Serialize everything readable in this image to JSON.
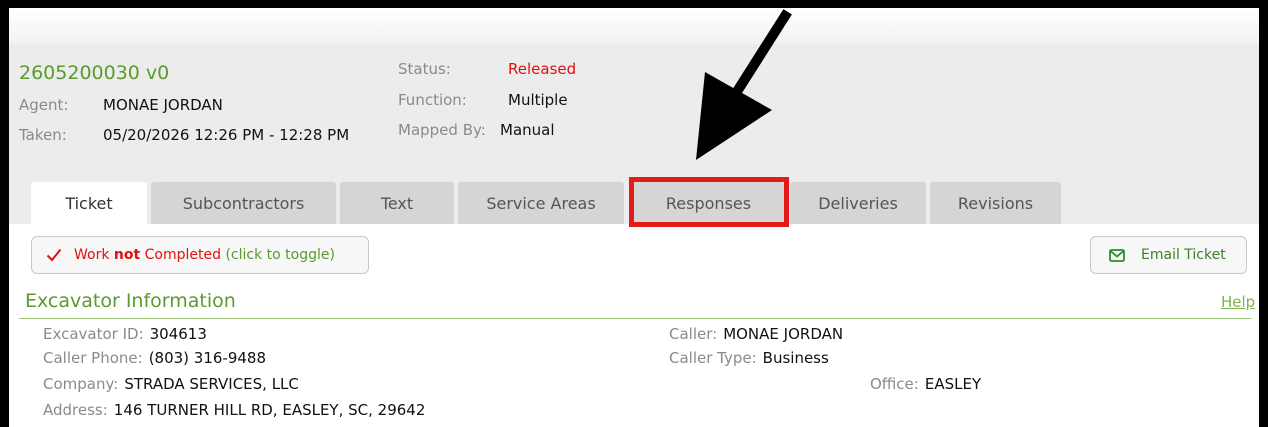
{
  "ticket": {
    "number": "2605200030 v0",
    "agent_label": "Agent:",
    "agent": "MONAE JORDAN",
    "taken_label": "Taken:",
    "taken": "05/20/2026 12:26 PM - 12:28 PM",
    "status_label": "Status:",
    "status": "Released",
    "function_label": "Function:",
    "function": "Multiple",
    "mapped_label": "Mapped By:",
    "mapped": "Manual"
  },
  "tabs": [
    {
      "label": "Ticket"
    },
    {
      "label": "Subcontractors"
    },
    {
      "label": "Text"
    },
    {
      "label": "Service Areas"
    },
    {
      "label": "Responses"
    },
    {
      "label": "Deliveries"
    },
    {
      "label": "Revisions"
    }
  ],
  "toggle": {
    "part1": "Work ",
    "part2": "not",
    "part3": " Completed",
    "hint": " (click to toggle)"
  },
  "email_button": "Email Ticket",
  "section": {
    "title": "Excavator Information",
    "help": "Help"
  },
  "excavator": {
    "excavator_id_label": "Excavator ID:",
    "excavator_id": "304613",
    "caller_phone_label": "Caller Phone:",
    "caller_phone": "(803) 316-9488",
    "company_label": "Company:",
    "company": "STRADA SERVICES, LLC",
    "address_label": "Address:",
    "address": "146 TURNER HILL RD, EASLEY, SC, 29642",
    "caller_label": "Caller:",
    "caller": "MONAE JORDAN",
    "caller_type_label": "Caller Type:",
    "caller_type": "Business",
    "office_label": "Office:",
    "office": "EASLEY"
  },
  "colors": {
    "accent_green": "#5a9a2e",
    "status_red": "#e01010",
    "highlight_red": "#e31b1b"
  }
}
